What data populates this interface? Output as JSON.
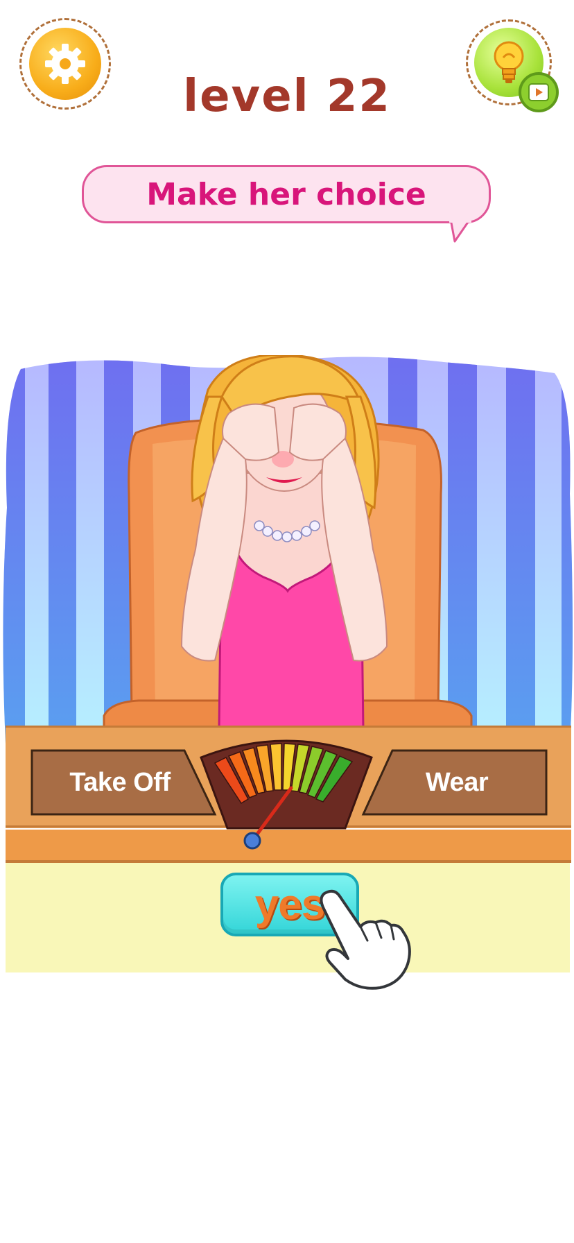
{
  "header": {
    "level": "level 22",
    "settings_icon": "gear-icon",
    "hint_icon": "lightbulb-icon",
    "hint_badge_icon": "video-play-icon"
  },
  "prompt": {
    "text": "Make her choice"
  },
  "meter": {
    "left_label": "Take Off",
    "right_label": "Wear"
  },
  "action": {
    "yes_label": "yes",
    "pointer_icon": "pointing-hand-icon"
  },
  "colors": {
    "level_text": "#a3382a",
    "bubble_text": "#d8157a",
    "bubble_border": "#e05597",
    "yes_button": "#33d5d8",
    "dress": "#ff48a8"
  }
}
